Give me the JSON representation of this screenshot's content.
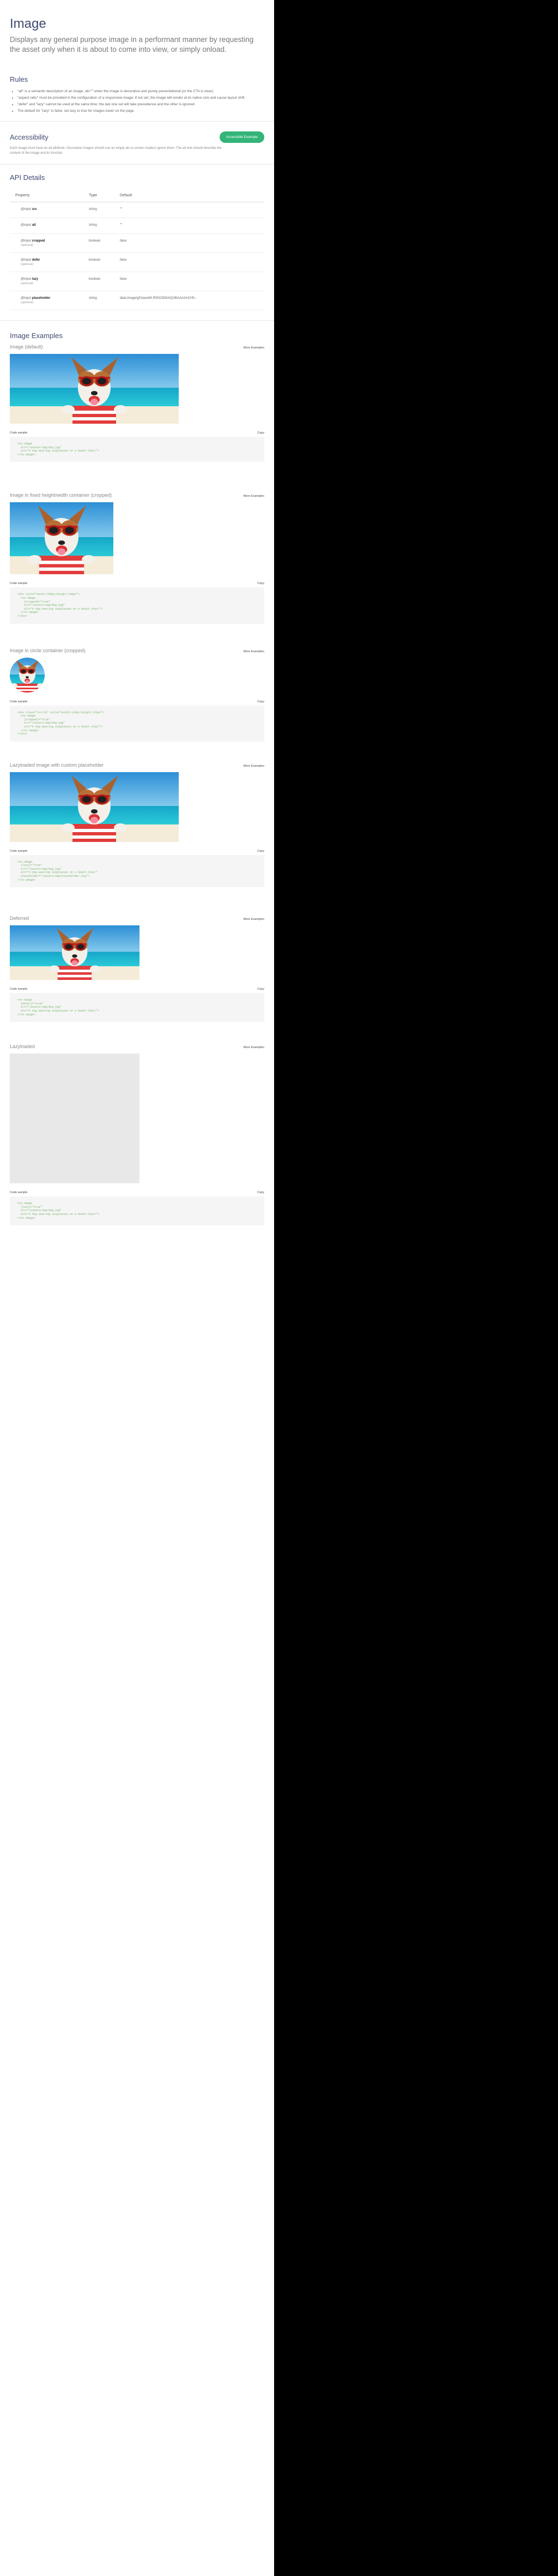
{
  "header": {
    "title": "Image",
    "intro": "Displays any general purpose image in a performant manner by requesting the asset only when it is about to come into view, or simply onload."
  },
  "rules": {
    "heading": "Rules",
    "items": [
      "\"alt\" is a semantic description of an image; alt=\"\" when the image is decorative and purely presentational (or the CTA is clear).",
      "\"aspect ratio\" must be provided in the configuration of a responsive image; if not set, the image will render at its native size and cause layout shift.",
      "\"defer\" and \"lazy\" cannot be used at the same time; the last one set will take precedence and the other is ignored.",
      "The default for \"lazy\" is false; set lazy to true for images lower on the page."
    ]
  },
  "accessibility": {
    "heading": "Accessibility",
    "button_label": "Accessible Example",
    "text": "Each image must have an alt attribute. Decorative images should use an empty alt so screen readers ignore them. The alt text should describe the content of the image and its function."
  },
  "api": {
    "heading": "API Details",
    "columns": [
      "Property",
      "Type",
      "Default"
    ],
    "rows": [
      {
        "prefix": "@input",
        "name": "src",
        "optional": "",
        "type": "string",
        "default": "\"\""
      },
      {
        "prefix": "@input",
        "name": "alt",
        "optional": "",
        "type": "string",
        "default": "\"\""
      },
      {
        "prefix": "@input",
        "name": "cropped",
        "optional": "(optional)",
        "type": "boolean",
        "default": "false"
      },
      {
        "prefix": "@input",
        "name": "defer",
        "optional": "(optional)",
        "type": "boolean",
        "default": "false"
      },
      {
        "prefix": "@input",
        "name": "lazy",
        "optional": "(optional)",
        "type": "boolean",
        "default": "false"
      },
      {
        "prefix": "@input",
        "name": "placeholder",
        "optional": "(optional)",
        "type": "string",
        "default": "data:image/gif;base64,R0lGODlhAQABAAAAACH5..."
      }
    ]
  },
  "examples": {
    "heading": "Image Examples",
    "more_label": "More Examples",
    "code_label": "Code sample",
    "copy_label": "Copy",
    "items": [
      {
        "title": "Image (default)",
        "code": "<nx-image\n  src=\"/assets/img/dog.jpg\"\n  alt=\"A dog wearing sunglasses on a beach chair\">\n</nx-image>"
      },
      {
        "title": "Image in fixed height/width container (cropped)",
        "code": "<div style=\"width:320px;height:240px\">\n  <nx-image\n    [cropped]=\"true\"\n    src=\"/assets/img/dog.jpg\"\n    alt=\"A dog wearing sunglasses on a beach chair\">\n  </nx-image>\n</div>"
      },
      {
        "title": "Image in circle container (cropped)",
        "code": "<div class=\"circle\" style=\"width:128px;height:128px\">\n  <nx-image\n    [cropped]=\"true\"\n    src=\"/assets/img/dog.jpg\"\n    alt=\"A dog wearing sunglasses on a beach chair\">\n  </nx-image>\n</div>"
      },
      {
        "title": "Lazyloaded image with custom placeholder",
        "code": "<nx-image\n  [lazy]=\"true\"\n  src=\"/assets/img/dog.jpg\"\n  alt=\"A dog wearing sunglasses on a beach chair\"\n  placeholder=\"/assets/img/placeholder.svg\">\n</nx-image>"
      },
      {
        "title": "Deferred",
        "code": "<nx-image\n  [defer]=\"true\"\n  src=\"/assets/img/dog.jpg\"\n  alt=\"A dog wearing sunglasses on a beach chair\">\n</nx-image>"
      },
      {
        "title": "Lazyloaded",
        "code": "<nx-image\n  [lazy]=\"true\"\n  src=\"/assets/img/dog.jpg\"\n  alt=\"A dog wearing sunglasses on a beach chair\">\n</nx-image>"
      }
    ]
  },
  "colors": {
    "title": "#3f4a73",
    "accent": "#33b579",
    "code_text": "#7bb66e",
    "code_tag": "#c96a53",
    "background_right": "#000000"
  }
}
